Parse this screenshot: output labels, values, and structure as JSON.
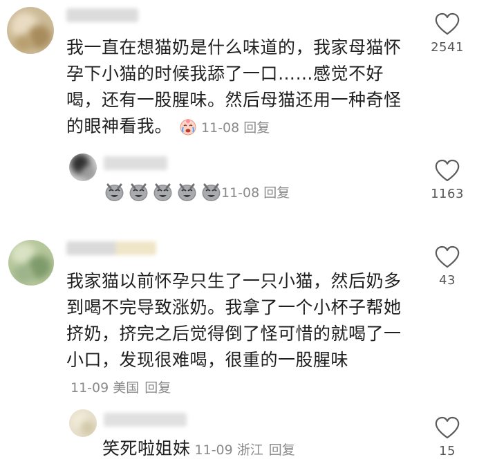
{
  "comments": [
    {
      "text": "我一直在想猫奶是什么味道的，我家母猫怀孕下小猫的时候我舔了一口……感觉不好喝，还有一股腥味。然后母猫还用一种奇怪的眼神看我。",
      "emoji_icon": "crying-face-icon",
      "date": "11-08",
      "reply_label": "回复",
      "likes": "2541",
      "reply": {
        "sticker_icon": "laughing-sticker-icon",
        "sticker_count": 5,
        "date": "11-08",
        "reply_label": "回复",
        "likes": "1163"
      }
    },
    {
      "text": "我家猫以前怀孕只生了一只小猫，然后奶多到喝不完导致涨奶。我拿了一个小杯子帮她挤奶，挤完之后觉得倒了怪可惜的就喝了一小口，发现很难喝，很重的一股腥味",
      "date": "11-09",
      "location": "美国",
      "reply_label": "回复",
      "likes": "43",
      "reply": {
        "text": "笑死啦姐妹",
        "date": "11-09",
        "location": "浙江",
        "reply_label": "回复",
        "likes": "15"
      }
    }
  ],
  "colors": {
    "text": "#1f1f1f",
    "meta": "#8a8a8a",
    "heart_stroke": "#5a5a5a",
    "background": "#ffffff"
  }
}
